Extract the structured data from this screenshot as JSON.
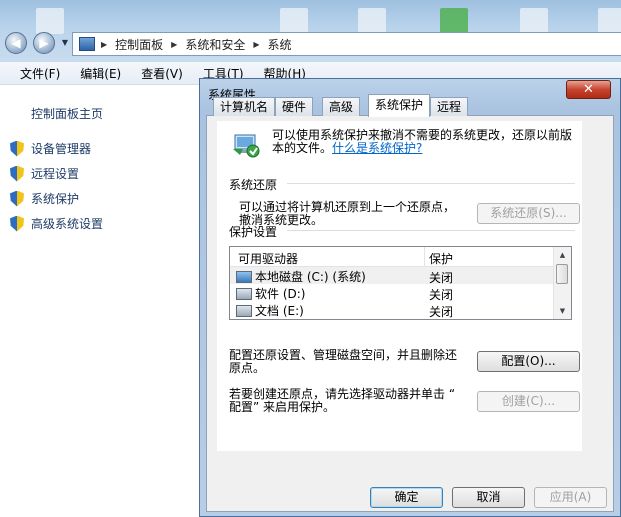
{
  "explorer": {
    "breadcrumb": [
      "控制面板",
      "系统和安全",
      "系统"
    ],
    "menu": [
      "文件(F)",
      "编辑(E)",
      "查看(V)",
      "工具(T)",
      "帮助(H)"
    ],
    "sidebar": {
      "home": "控制面板主页",
      "items": [
        "设备管理器",
        "远程设置",
        "系统保护",
        "高级系统设置"
      ]
    }
  },
  "dialog": {
    "title": "系统属性",
    "close_label": "✕",
    "tabs": [
      "计算机名",
      "硬件",
      "高级",
      "系统保护",
      "远程"
    ],
    "active_tab": "系统保护",
    "intro_line1": "可以使用系统保护来撤消不需要的系统更改，还原以前版",
    "intro_line2_prefix": "本的文件。",
    "intro_link": "什么是系统保护?",
    "restore_group": "系统还原",
    "restore_desc_line1": "可以通过将计算机还原到上一个还原点，",
    "restore_desc_line2": "撤消系统更改。",
    "restore_button": "系统还原(S)...",
    "protection_group": "保护设置",
    "list_headers": [
      "可用驱动器",
      "保护"
    ],
    "drives": [
      {
        "name": "本地磁盘 (C:) (系统)",
        "status": "关闭"
      },
      {
        "name": "软件 (D:)",
        "status": "关闭"
      },
      {
        "name": "文档 (E:)",
        "status": "关闭"
      }
    ],
    "config_desc_line1": "配置还原设置、管理磁盘空间，并且删除还",
    "config_desc_line2": "原点。",
    "config_button": "配置(O)...",
    "create_desc_line1": "若要创建还原点，请先选择驱动器并单击 “",
    "create_desc_line2": "配置” 来启用保护。",
    "create_button": "创建(C)...",
    "ok_button": "确定",
    "cancel_button": "取消",
    "apply_button": "应用(A)"
  }
}
